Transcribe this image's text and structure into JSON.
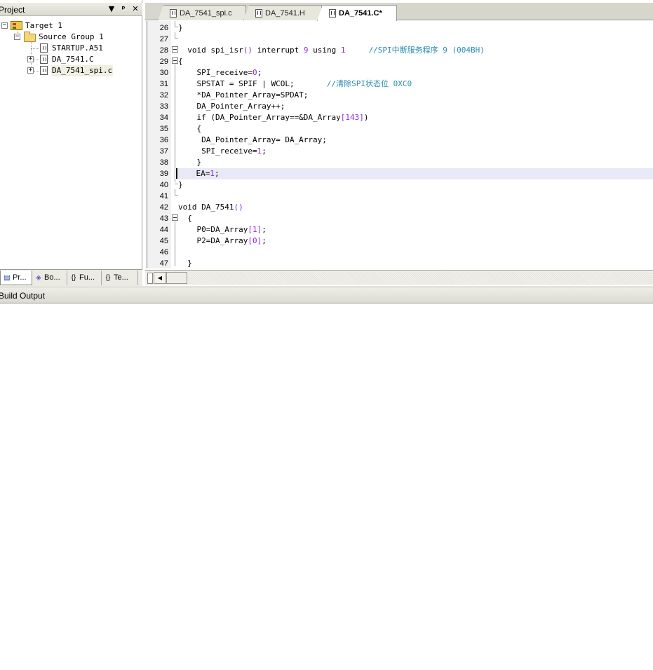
{
  "project_panel": {
    "title": "Project",
    "buttons": {
      "dropdown": "▼",
      "pin": "ᵖ",
      "close": "✕"
    },
    "tree": [
      {
        "label": "Target 1",
        "icon": "target-icon",
        "expand": "−"
      },
      {
        "label": "Source Group 1",
        "icon": "folder-icon",
        "expand": "−"
      },
      {
        "label": "STARTUP.A51",
        "icon": "file-icon"
      },
      {
        "label": "DA_7541.C",
        "icon": "file-icon",
        "expand": "+"
      },
      {
        "label": "DA_7541_spi.c",
        "icon": "file-icon",
        "expand": "+"
      }
    ],
    "tabs": [
      {
        "label": "Pr...",
        "icon": "project-icon"
      },
      {
        "label": "Bo...",
        "icon": "books-icon"
      },
      {
        "label": "Fu...",
        "icon": "functions-icon",
        "glyph": "{}"
      },
      {
        "label": "Te...",
        "icon": "templates-icon",
        "glyph": "{}"
      }
    ]
  },
  "editor": {
    "tabs": [
      {
        "label": "DA_7541_spi.c",
        "active": false
      },
      {
        "label": "DA_7541.H",
        "active": false
      },
      {
        "label": "DA_7541.C*",
        "active": true
      }
    ],
    "lines": [
      {
        "n": "26",
        "text": "}"
      },
      {
        "n": "27",
        "text": ""
      },
      {
        "n": "28",
        "text": "  void spi_isr() interrupt 9 using 1     //SPI中断服务程序 9 (004BH)"
      },
      {
        "n": "29",
        "text": "{"
      },
      {
        "n": "30",
        "text": "    SPI_receive=0;"
      },
      {
        "n": "31",
        "text": "    SPSTAT = SPIF | WCOL;       //清除SPI状态位 0XC0"
      },
      {
        "n": "32",
        "text": "    *DA_Pointer_Array=SPDAT;"
      },
      {
        "n": "33",
        "text": "    DA_Pointer_Array++;"
      },
      {
        "n": "34",
        "text": "    if (DA_Pointer_Array==&DA_Array[143])"
      },
      {
        "n": "35",
        "text": "    {"
      },
      {
        "n": "36",
        "text": "     DA_Pointer_Array= DA_Array;"
      },
      {
        "n": "37",
        "text": "     SPI_receive=1;"
      },
      {
        "n": "38",
        "text": "    }"
      },
      {
        "n": "39",
        "text": "    EA=1;"
      },
      {
        "n": "40",
        "text": "}"
      },
      {
        "n": "41",
        "text": ""
      },
      {
        "n": "42",
        "text": "void DA_7541()"
      },
      {
        "n": "43",
        "text": "  {"
      },
      {
        "n": "44",
        "text": "    P0=DA_Array[1];"
      },
      {
        "n": "45",
        "text": "    P2=DA_Array[0];"
      },
      {
        "n": "46",
        "text": ""
      },
      {
        "n": "47",
        "text": "  }"
      }
    ],
    "current_line": "39"
  },
  "build_output": {
    "title": "Build Output"
  },
  "colors": {
    "comment": "#2a8cae",
    "number": "#8a2be2",
    "current_line_bg": "#e8e8f7"
  }
}
